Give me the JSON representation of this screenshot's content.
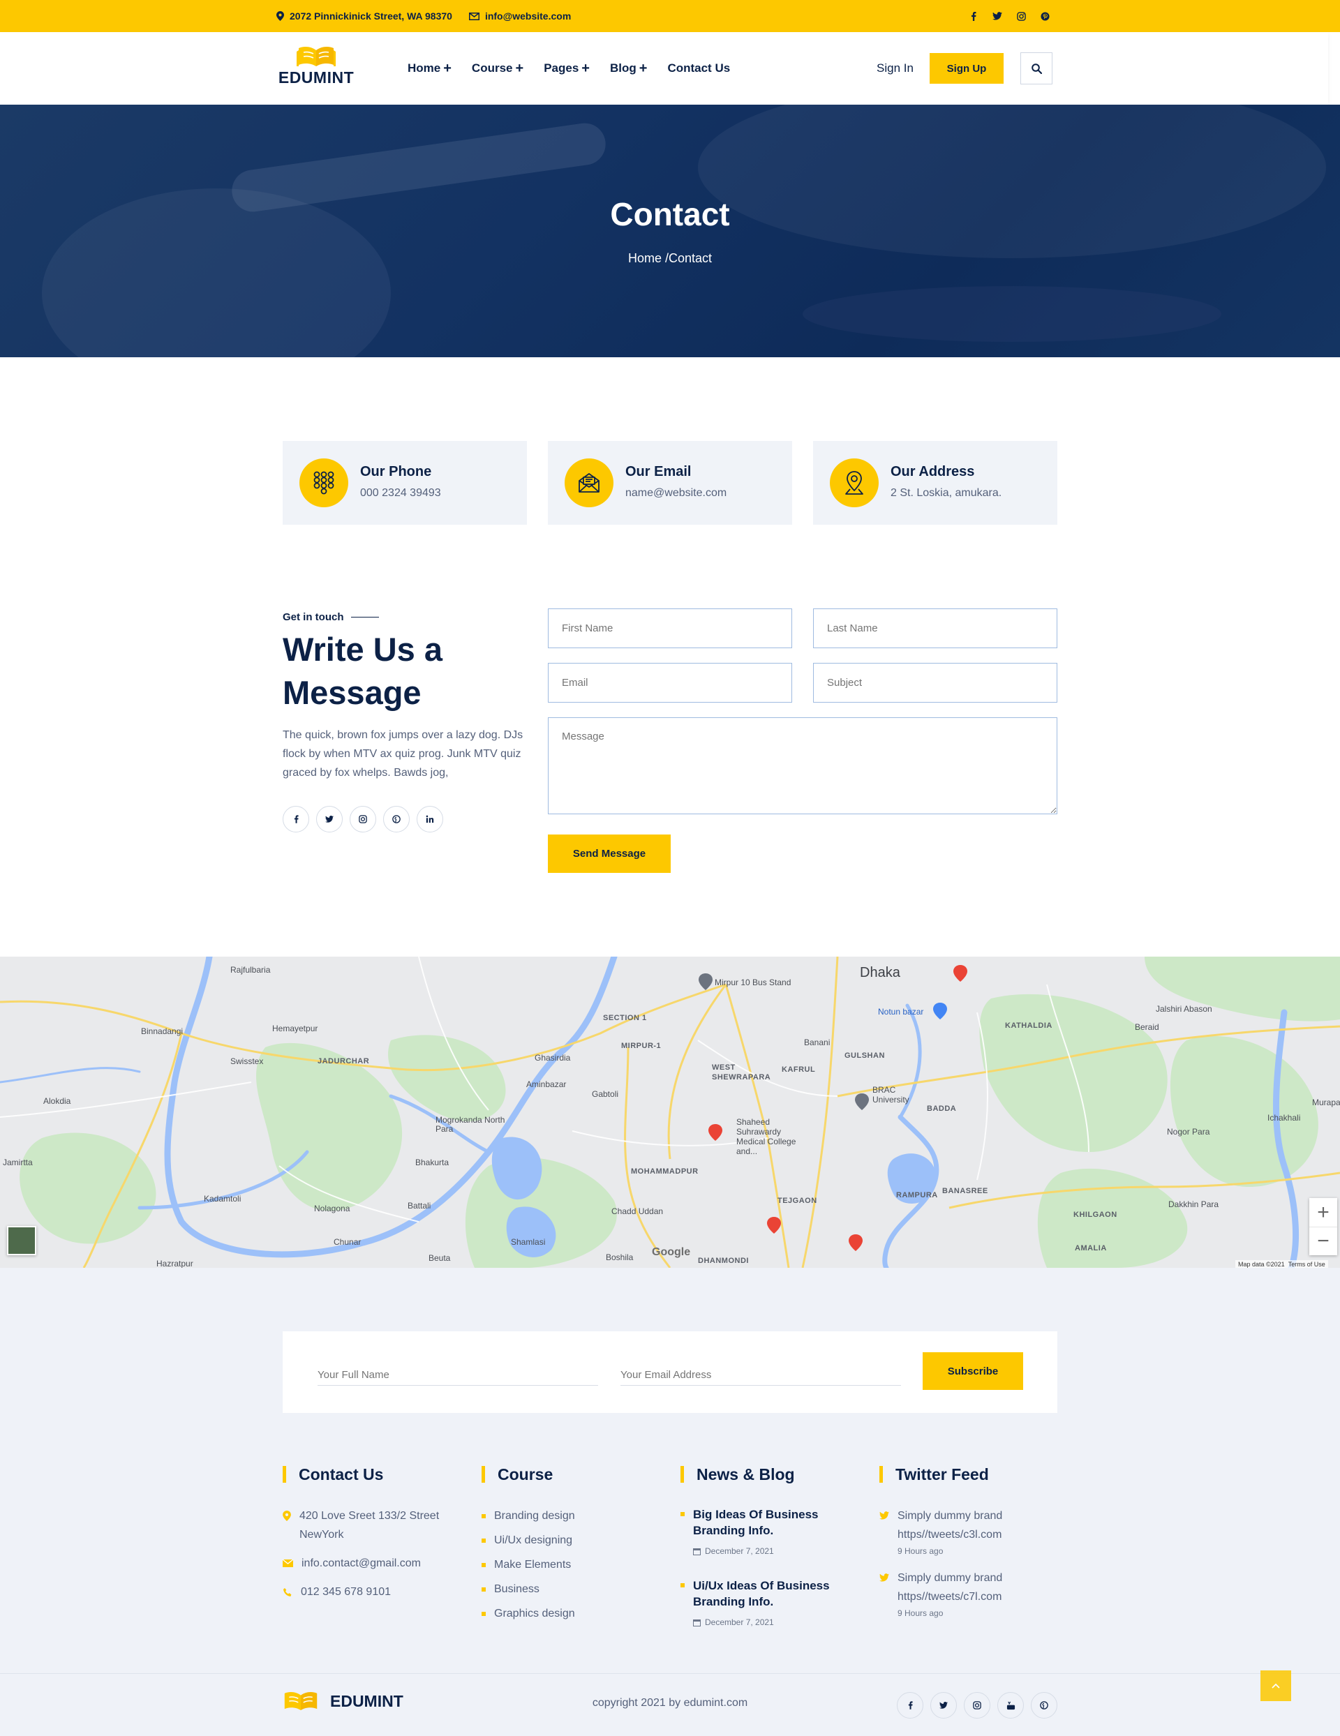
{
  "topbar": {
    "address": "2072 Pinnickinick Street, WA 98370",
    "email": "info@website.com",
    "social_icons": [
      "facebook-icon",
      "twitter-icon",
      "instagram-icon",
      "pinterest-icon"
    ]
  },
  "brand": {
    "name": "EDUMINT",
    "accent": "#fdc800",
    "navy": "#0c2146"
  },
  "nav": {
    "items": [
      {
        "label": "Home",
        "suffix": "+"
      },
      {
        "label": "Course",
        "suffix": "+"
      },
      {
        "label": "Pages",
        "suffix": "+"
      },
      {
        "label": "Blog",
        "suffix": "+"
      },
      {
        "label": "Contact Us",
        "suffix": ""
      }
    ],
    "sign_in": "Sign In",
    "sign_up": "Sign Up"
  },
  "hero": {
    "title": "Contact",
    "crumb_home": "Home",
    "crumb_sep": "/",
    "crumb_current": "Contact"
  },
  "info_cards": [
    {
      "title": "Our Phone",
      "value": "000 2324 39493",
      "icon": "phone-keypad-icon"
    },
    {
      "title": "Our Email",
      "value": "name@website.com",
      "icon": "envelope-open-icon"
    },
    {
      "title": "Our Address",
      "value": "2 St. Loskia, amukara.",
      "icon": "map-pin-icon"
    }
  ],
  "message": {
    "eyebrow": "Get in touch",
    "title": "Write Us a Message",
    "text": "The quick, brown fox jumps over a lazy dog. DJs flock by when MTV ax quiz prog. Junk MTV quiz graced by fox whelps. Bawds jog,",
    "social_icons": [
      "facebook-icon",
      "twitter-icon",
      "instagram-icon",
      "pinterest-icon",
      "linkedin-icon"
    ],
    "form": {
      "first_name": "First Name",
      "last_name": "Last Name",
      "email": "Email",
      "subject": "Subject",
      "message": "Message",
      "submit": "Send Message"
    }
  },
  "map": {
    "labels": [
      "Rajfulbaria",
      "Binnadangi",
      "Hemayetpur",
      "Swisstex",
      "JADURCHAR",
      "Alokdia",
      "Jamirtta",
      "Kadamtoli",
      "Nolagona",
      "Battali",
      "Chunar",
      "Hazratpur",
      "Beuta",
      "Shamlasi",
      "Bhakurta",
      "Mogrokanda North Para",
      "Aminbazar",
      "Gabtoli",
      "Ghasirdia",
      "SECTION 1",
      "MIRPUR-1",
      "WEST SHEWRAPARA",
      "KAFRUL",
      "GULSHAN",
      "Dhaka",
      "Notun bazar",
      "Mirpur 10 Bus Stand",
      "BRAC University",
      "BADDA",
      "KATHALDIA",
      "Jalshiri Abason",
      "Beraid",
      "Nogor Para",
      "Ichakhali",
      "Murapara",
      "Shaheed Suhrawardy Medical College and...",
      "MOHAMMADPUR",
      "TEJGAON",
      "RAMPURA",
      "BANASREE",
      "KHILGAON",
      "Dakkhin Para",
      "AMALIA",
      "Chadd Uddan",
      "Boshila",
      "DHANMONDI",
      "Banani"
    ],
    "google": "Google",
    "attribution": "Map data ©2021",
    "terms": "Terms of Use",
    "zoom_in": "+",
    "zoom_out": "−"
  },
  "subscribe": {
    "name_placeholder": "Your Full Name",
    "email_placeholder": "Your Email Address",
    "button": "Subscribe"
  },
  "footer": {
    "contact": {
      "title": "Contact Us",
      "address_line1": "420 Love Sreet 133/2 Street",
      "address_line2": "NewYork",
      "email": "info.contact@gmail.com",
      "phone": "012 345 678 9101"
    },
    "course": {
      "title": "Course",
      "items": [
        "Branding design",
        "Ui/Ux designing",
        "Make Elements",
        "Business",
        "Graphics design"
      ]
    },
    "news": {
      "title": "News & Blog",
      "items": [
        {
          "title": "Big Ideas Of Business Branding Info.",
          "date": "December 7, 2021"
        },
        {
          "title": "Ui/Ux Ideas Of Business Branding Info.",
          "date": "December 7, 2021"
        }
      ]
    },
    "twitter": {
      "title": "Twitter Feed",
      "items": [
        {
          "line1": "Simply dummy brand",
          "line2": "https//tweets/c3l.com",
          "ago": "9 Hours ago"
        },
        {
          "line1": "Simply dummy brand",
          "line2": "https//tweets/c7l.com",
          "ago": "9 Hours ago"
        }
      ]
    },
    "copyright": "copyright 2021 by edumint.com",
    "social_icons": [
      "facebook-icon",
      "twitter-icon",
      "instagram-icon",
      "youtube-icon",
      "pinterest-icon"
    ]
  }
}
